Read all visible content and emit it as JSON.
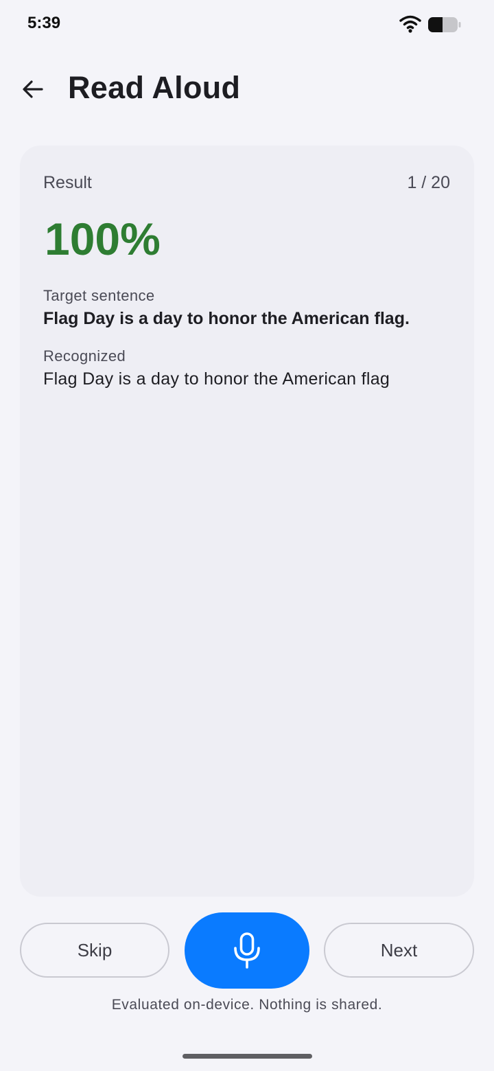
{
  "status_bar": {
    "time": "5:39",
    "icons": [
      "wifi-icon",
      "battery-icon"
    ]
  },
  "header": {
    "back_icon": "arrow-left-icon",
    "title": "Read Aloud"
  },
  "result": {
    "label": "Result",
    "progress": "1 / 20",
    "score": "100%",
    "score_color": "#2e7d32",
    "target_label": "Target sentence",
    "target_sentence": "Flag Day is a day to honor the American flag.",
    "recognized_label": "Recognized",
    "recognized_sentence": "Flag Day is a day to honor the American flag"
  },
  "actions": {
    "skip_label": "Skip",
    "mic_icon": "microphone-icon",
    "mic_color": "#0a7bff",
    "next_label": "Next"
  },
  "footer": {
    "note": "Evaluated on-device. Nothing is shared."
  }
}
